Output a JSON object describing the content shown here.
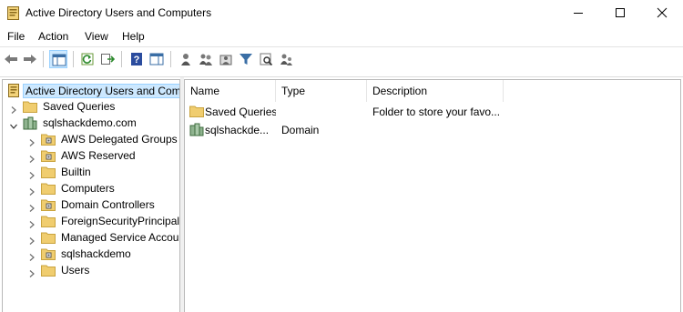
{
  "window": {
    "title": "Active Directory Users and Computers"
  },
  "menu": {
    "items": [
      {
        "label": "File"
      },
      {
        "label": "Action"
      },
      {
        "label": "View"
      },
      {
        "label": "Help"
      }
    ]
  },
  "toolbar": {
    "buttons": [
      {
        "icon": "back-arrow-icon"
      },
      {
        "icon": "forward-arrow-icon"
      },
      {
        "icon": "show-hide-console-tree-icon"
      },
      {
        "icon": "refresh-icon"
      },
      {
        "icon": "export-list-icon"
      },
      {
        "icon": "help-icon"
      },
      {
        "icon": "show-hide-action-pane-icon"
      },
      {
        "icon": "create-user-icon"
      },
      {
        "icon": "create-group-icon"
      },
      {
        "icon": "create-ou-icon"
      },
      {
        "icon": "filter-icon"
      },
      {
        "icon": "find-icon"
      },
      {
        "icon": "add-to-group-icon"
      }
    ]
  },
  "tree": {
    "root": {
      "label": "Active Directory Users and Com",
      "icon": "ad-snapin-icon"
    },
    "nodes": [
      {
        "label": "Saved Queries",
        "icon": "folder-icon"
      },
      {
        "label": "sqlshackdemo.com",
        "icon": "domain-icon"
      },
      {
        "label": "AWS Delegated Groups",
        "icon": "ou-folder-icon"
      },
      {
        "label": "AWS Reserved",
        "icon": "ou-folder-icon"
      },
      {
        "label": "Builtin",
        "icon": "folder-icon"
      },
      {
        "label": "Computers",
        "icon": "folder-icon"
      },
      {
        "label": "Domain Controllers",
        "icon": "ou-folder-icon"
      },
      {
        "label": "ForeignSecurityPrincipals",
        "icon": "folder-icon"
      },
      {
        "label": "Managed Service Accour",
        "icon": "folder-icon"
      },
      {
        "label": "sqlshackdemo",
        "icon": "ou-folder-icon"
      },
      {
        "label": "Users",
        "icon": "folder-icon"
      }
    ]
  },
  "list": {
    "columns": [
      {
        "label": "Name"
      },
      {
        "label": "Type"
      },
      {
        "label": "Description"
      }
    ],
    "rows": [
      {
        "name": "Saved Queries",
        "type": "",
        "description": "Folder to store your favo...",
        "icon": "folder-icon"
      },
      {
        "name": "sqlshackde...",
        "type": "Domain",
        "description": "",
        "icon": "domain-icon"
      }
    ]
  },
  "colors": {
    "selection": "#cce8ff",
    "selection_border": "#99d1ff",
    "folder": "#e8c26a",
    "accent": "#1e6fc0"
  }
}
